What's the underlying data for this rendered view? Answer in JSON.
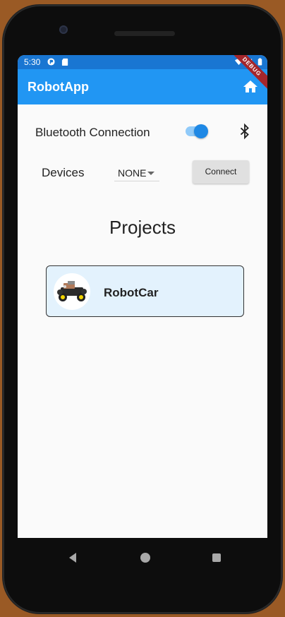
{
  "status_bar": {
    "time": "5:30"
  },
  "app_bar": {
    "title": "RobotApp",
    "debug_banner": "DEBUG"
  },
  "bluetooth": {
    "label": "Bluetooth Connection",
    "enabled": true
  },
  "devices": {
    "label": "Devices",
    "selected": "NONE",
    "connect_label": "Connect"
  },
  "projects": {
    "title": "Projects",
    "items": [
      {
        "name": "RobotCar"
      }
    ]
  },
  "colors": {
    "app_bar": "#2196f3",
    "status_bar": "#1976d2",
    "accent": "#1e88e5",
    "card_bg": "#e3f2fd"
  }
}
